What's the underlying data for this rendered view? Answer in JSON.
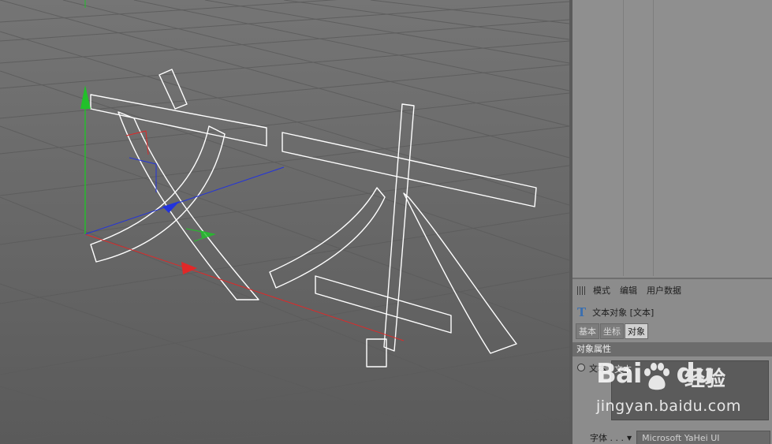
{
  "attributes": {
    "menu": [
      "模式",
      "编辑",
      "用户数据"
    ],
    "object_title": "文本对象 [文本]",
    "tabs": [
      "基本",
      "坐标",
      "对象"
    ],
    "active_tab": "对象",
    "section_title": "对象属性",
    "text_label": "文本",
    "text_value": "文本",
    "font_label": "字体 . . .",
    "font_value": "Microsoft YaHei UI"
  },
  "watermark": {
    "brand_a": "Bai",
    "brand_b": "du",
    "brand_cn": "经验",
    "url": "jingyan.baidu.com"
  },
  "colors": {
    "viewport_bg": "#6a6a6a",
    "panel_bg": "#8f8f8f",
    "axis_x": "#e02020",
    "axis_y": "#20c020",
    "axis_z": "#2030e0",
    "spline": "#ffffff",
    "text_icon": "#3a6fb0"
  }
}
